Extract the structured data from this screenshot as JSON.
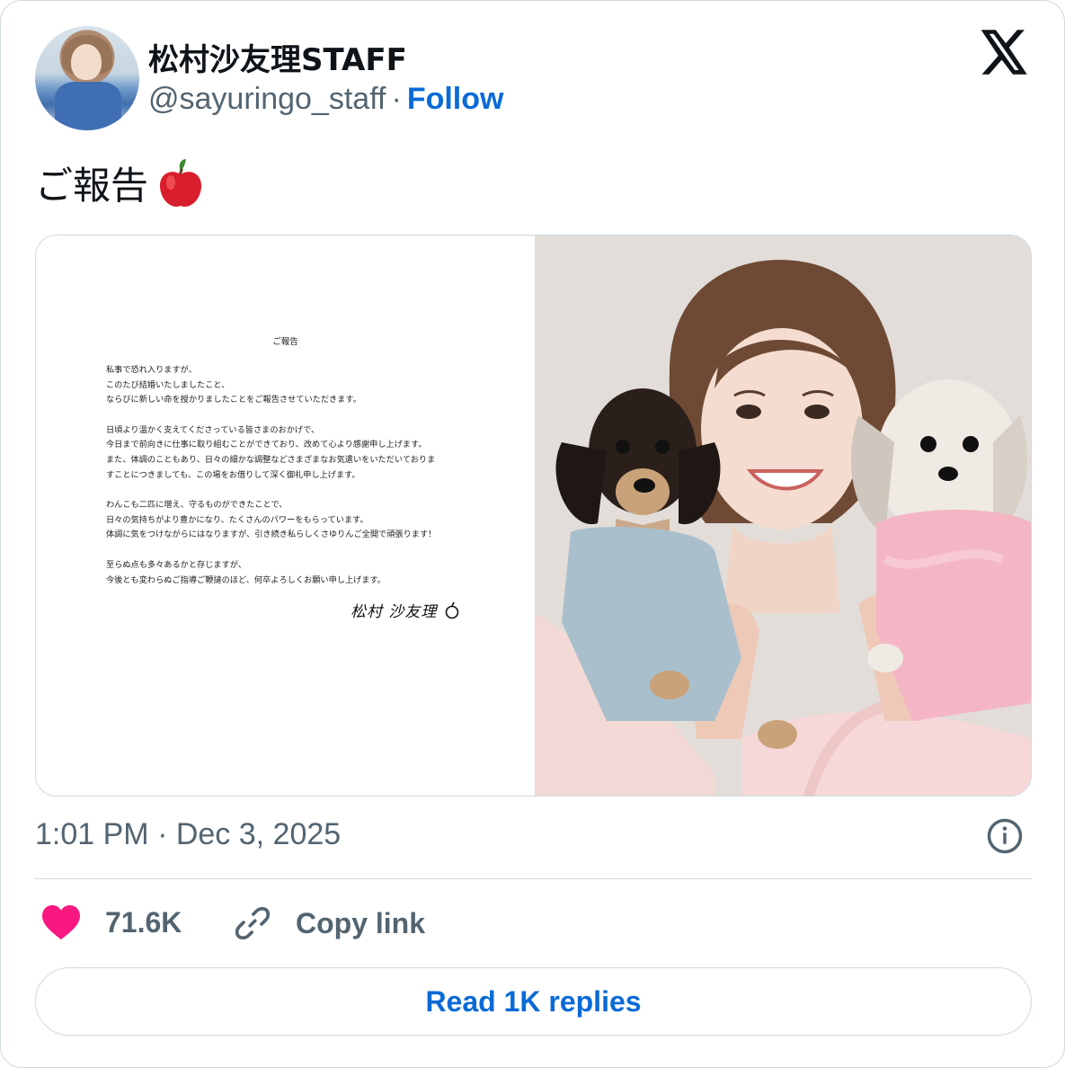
{
  "user": {
    "display_name": "松村沙友理STAFF",
    "handle": "@sayuringo_staff",
    "separator": "·",
    "follow_label": "Follow"
  },
  "tweet": {
    "text": "ご報告"
  },
  "letter": {
    "title": "ご報告",
    "lines": [
      "私事で恐れ入りますが、",
      "このたび結婚いたしましたこと、",
      "ならびに新しい命を授かりましたことをご報告させていただきます。",
      "",
      "日頃より温かく支えてくださっている皆さまのおかげで、",
      "今日まで前向きに仕事に取り組むことができており、改めて心より感謝申し上げます。",
      "また、体調のこともあり、日々の細かな調整などさまざまなお気遣いをいただいておりま",
      "すことにつきましても、この場をお借りして深く御礼申し上げます。",
      "",
      "わんこも二匹に増え、守るものができたことで、",
      "日々の気持ちがより豊かになり、たくさんのパワーをもらっています。",
      "体調に気をつけながらにはなりますが、引き続き私らしくさゆりんご全開で頑張ります！",
      "",
      "至らぬ点も多々あるかと存じますが、",
      "今後とも変わらぬご指導ご鞭撻のほど、何卒よろしくお願い申し上げます。"
    ],
    "signature": "松村 沙友理"
  },
  "meta": {
    "timestamp": "1:01 PM · Dec 3, 2025"
  },
  "actions": {
    "like_count": "71.6K",
    "copy_label": "Copy link",
    "read_replies_label": "Read 1K replies"
  },
  "colors": {
    "link_blue": "#0a6ad8",
    "secondary_text": "#536471",
    "heart_pink": "#f91880",
    "border": "#cfd9de"
  },
  "icons": {
    "logo": "x-logo-icon",
    "emoji": "red-apple-icon",
    "info": "info-icon",
    "like": "heart-icon",
    "copy": "link-icon"
  }
}
